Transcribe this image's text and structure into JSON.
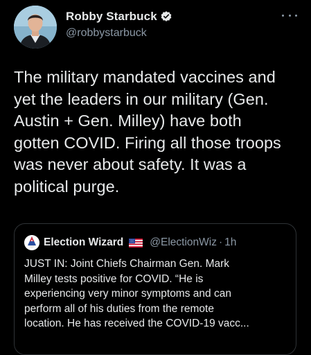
{
  "tweet": {
    "author": {
      "display_name": "Robby Starbuck",
      "handle": "@robbystarbuck",
      "verified": true,
      "avatar_icon": "person-avatar"
    },
    "more_icon": "more-dots-icon",
    "text": "The military mandated vaccines and\nyet the leaders in our military (Gen.\nAustin + Gen. Milley) have both\ngotten COVID. Firing all those troops\nwas never about safety. It was a\npolitical purge.",
    "quote": {
      "author": {
        "display_name": "Election Wizard",
        "flag_icon": "us-flag-icon",
        "handle": "@ElectionWiz",
        "separator": "·",
        "time": "1h",
        "avatar_icon": "wizard-avatar"
      },
      "text": "JUST IN: Joint Chiefs Chairman Gen. Mark\nMilley tests positive for COVID. “He is\nexperiencing very minor symptoms and can\nperform all of his duties from the remote\nlocation.  He has received the COVID-19 vacc..."
    }
  },
  "colors": {
    "background": "#000000",
    "text_primary": "#e7e9ea",
    "text_secondary": "#8b98a5",
    "border": "#2f3336",
    "verified_badge": "#e7e9ea"
  }
}
